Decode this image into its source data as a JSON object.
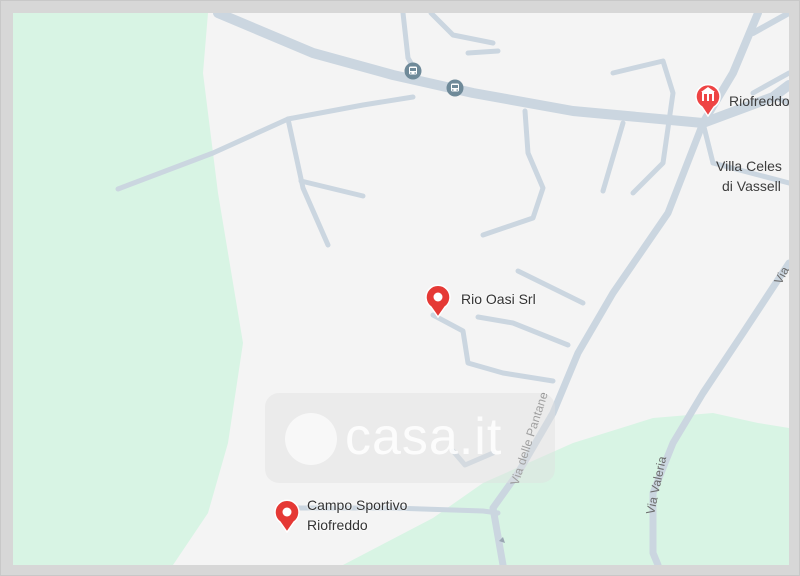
{
  "map": {
    "roads": {
      "via_delle_pantane": "Via delle Pantane",
      "via_valeria": "Via Valeria",
      "via_valeria_short": "Via"
    },
    "places": {
      "riofreddo": "Riofreddo",
      "villa_line1": "Villa Celes",
      "villa_line2": "di Vassell"
    },
    "pois": {
      "rio_oasi": "Rio Oasi Srl",
      "campo_line1": "Campo Sportivo",
      "campo_line2": "Riofreddo"
    },
    "watermark": "casa.it",
    "colors": {
      "land": "#f4f4f4",
      "park": "#d8f4e4",
      "road": "#cbd6e0",
      "poi_pin": "#e53935",
      "town_pin": "#ee4444"
    },
    "icons": [
      "bus-stop-icon",
      "bus-stop-icon",
      "town-hall-icon",
      "location-pin-icon",
      "location-pin-icon"
    ]
  }
}
